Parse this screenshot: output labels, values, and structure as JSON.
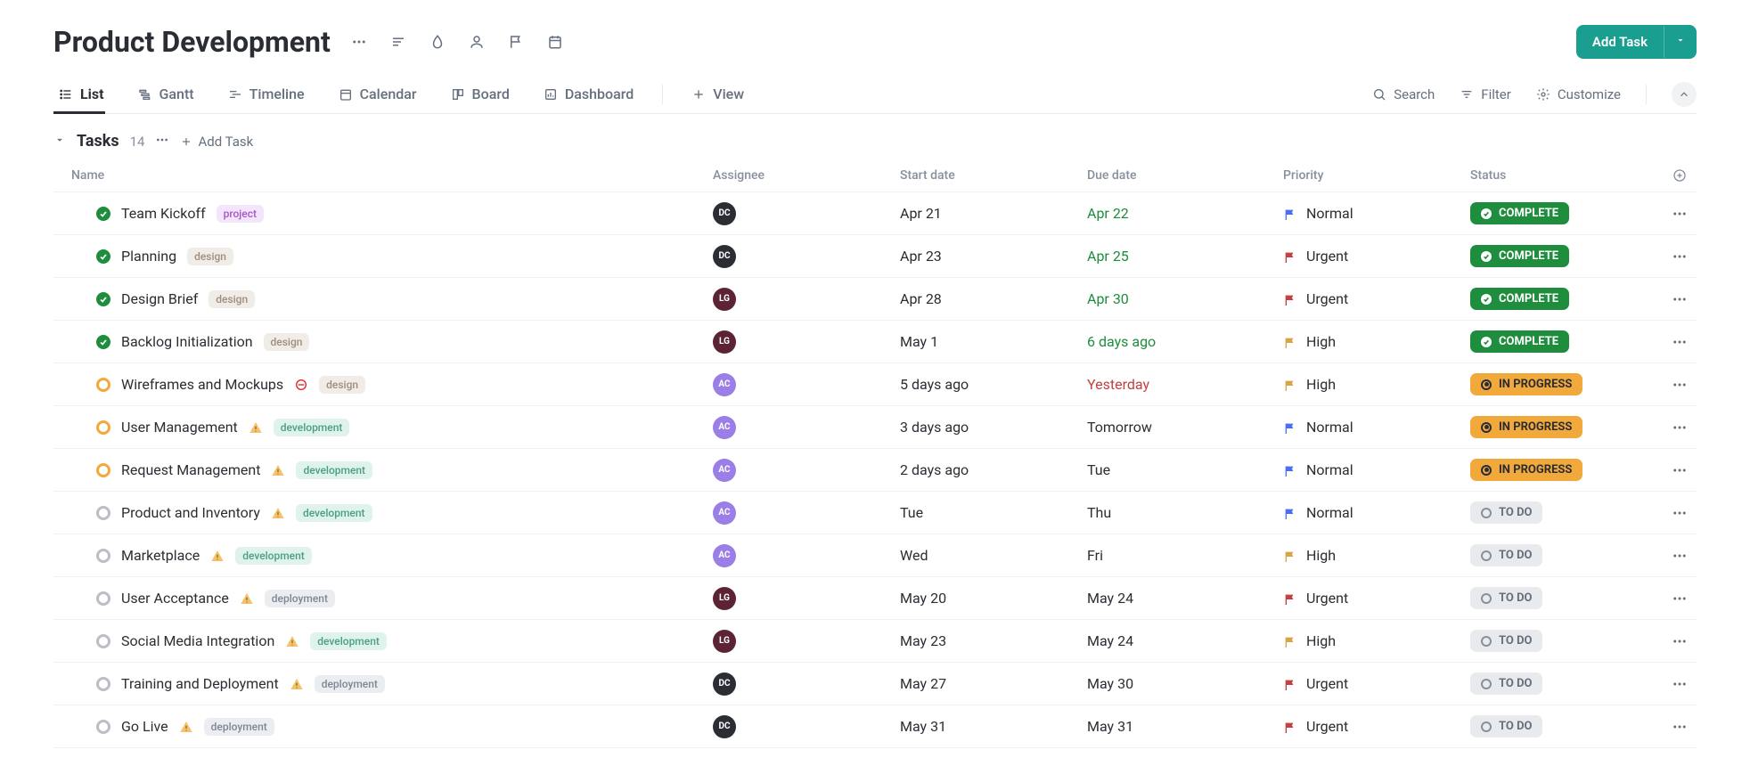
{
  "header": {
    "title": "Product Development",
    "add_task": "Add Task"
  },
  "tabs": [
    {
      "label": "List",
      "active": true
    },
    {
      "label": "Gantt"
    },
    {
      "label": "Timeline"
    },
    {
      "label": "Calendar"
    },
    {
      "label": "Board"
    },
    {
      "label": "Dashboard"
    }
  ],
  "tabs_extra": {
    "view": "View"
  },
  "toolbar": {
    "search": "Search",
    "filter": "Filter",
    "customize": "Customize"
  },
  "group": {
    "name": "Tasks",
    "count": "14",
    "add": "Add Task"
  },
  "columns": {
    "name": "Name",
    "assignee": "Assignee",
    "start": "Start date",
    "due": "Due date",
    "priority": "Priority",
    "status": "Status"
  },
  "priorities": {
    "normal": "Normal",
    "urgent": "Urgent",
    "high": "High"
  },
  "statuses": {
    "complete": "COMPLETE",
    "inprogress": "IN PROGRESS",
    "todo": "TO DO"
  },
  "rows": [
    {
      "name": "Team Kickoff",
      "tag": "project",
      "assignee": "DC",
      "start": "Apr 21",
      "due": "Apr 22",
      "due_cls": "green",
      "priority": "normal",
      "status": "complete"
    },
    {
      "name": "Planning",
      "tag": "design",
      "assignee": "DC",
      "start": "Apr 23",
      "due": "Apr 25",
      "due_cls": "green",
      "priority": "urgent",
      "status": "complete"
    },
    {
      "name": "Design Brief",
      "tag": "design",
      "assignee": "LG",
      "start": "Apr 28",
      "due": "Apr 30",
      "due_cls": "green",
      "priority": "urgent",
      "status": "complete"
    },
    {
      "name": "Backlog Initialization",
      "tag": "design",
      "assignee": "LG",
      "start": "May 1",
      "due": "6 days ago",
      "due_cls": "green",
      "priority": "high",
      "status": "complete"
    },
    {
      "name": "Wireframes and Mockups",
      "block": true,
      "tag": "design",
      "assignee": "AC",
      "start": "5 days ago",
      "due": "Yesterday",
      "due_cls": "red",
      "priority": "high",
      "status": "inprogress"
    },
    {
      "name": "User Management",
      "warn": true,
      "tag": "development",
      "assignee": "AC",
      "start": "3 days ago",
      "due": "Tomorrow",
      "priority": "normal",
      "status": "inprogress"
    },
    {
      "name": "Request Management",
      "warn": true,
      "tag": "development",
      "assignee": "AC",
      "start": "2 days ago",
      "due": "Tue",
      "priority": "normal",
      "status": "inprogress"
    },
    {
      "name": "Product and Inventory",
      "warn": true,
      "tag": "development",
      "assignee": "AC",
      "start": "Tue",
      "due": "Thu",
      "priority": "normal",
      "status": "todo"
    },
    {
      "name": "Marketplace",
      "warn": true,
      "tag": "development",
      "assignee": "AC",
      "start": "Wed",
      "due": "Fri",
      "priority": "high",
      "status": "todo"
    },
    {
      "name": "User Acceptance",
      "warn": true,
      "tag": "deployment",
      "assignee": "LG",
      "start": "May 20",
      "due": "May 24",
      "priority": "urgent",
      "status": "todo"
    },
    {
      "name": "Social Media Integration",
      "warn": true,
      "tag": "development",
      "assignee": "LG",
      "start": "May 23",
      "due": "May 24",
      "priority": "high",
      "status": "todo"
    },
    {
      "name": "Training and Deployment",
      "warn": true,
      "tag": "deployment",
      "assignee": "DC",
      "start": "May 27",
      "due": "May 30",
      "priority": "urgent",
      "status": "todo"
    },
    {
      "name": "Go Live",
      "warn": true,
      "tag": "deployment",
      "assignee": "DC",
      "start": "May 31",
      "due": "May 31",
      "priority": "urgent",
      "status": "todo"
    }
  ]
}
